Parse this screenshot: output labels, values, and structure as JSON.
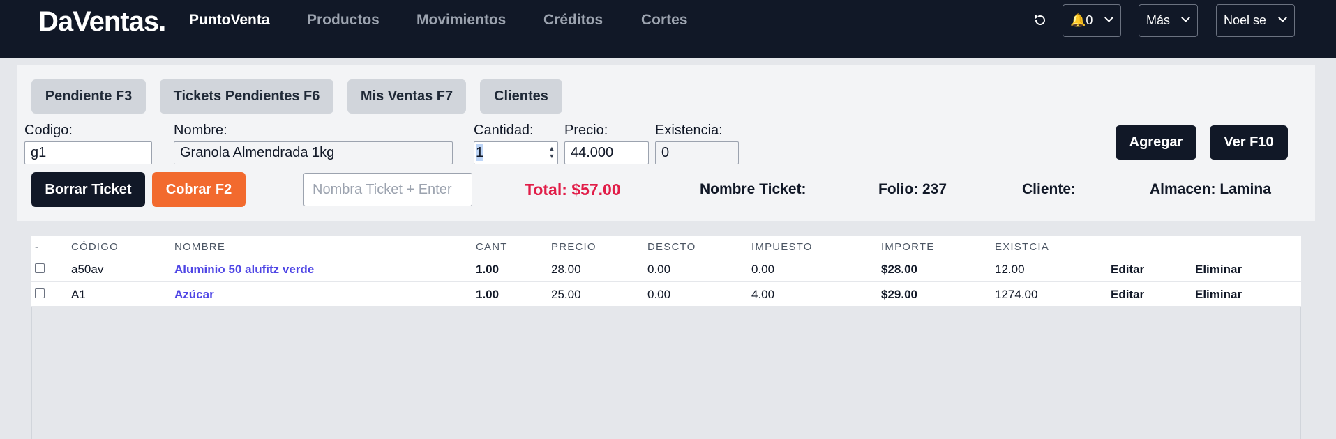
{
  "brand": "DaVentas.",
  "nav": {
    "links": [
      "PuntoVenta",
      "Productos",
      "Movimientos",
      "Créditos",
      "Cortes"
    ],
    "refresh_icon": "refresh-icon",
    "notifications": "🔔0",
    "mas": "Más",
    "user": "Noel se"
  },
  "toolbar": {
    "tabs": [
      "Pendiente F3",
      "Tickets Pendientes F6",
      "Mis Ventas F7",
      "Clientes"
    ]
  },
  "form": {
    "codigo_label": "Codigo:",
    "codigo_value": "g1",
    "nombre_label": "Nombre:",
    "nombre_value": "Granola Almendrada 1kg",
    "cantidad_label": "Cantidad:",
    "cantidad_value": "1",
    "precio_label": "Precio:",
    "precio_value": "44.000",
    "existencia_label": "Existencia:",
    "existencia_value": "0",
    "agregar": "Agregar",
    "ver": "Ver F10",
    "borrar": "Borrar Ticket",
    "cobrar": "Cobrar F2",
    "ticket_placeholder": "Nombra Ticket + Enter",
    "total": "Total: $57.00",
    "nombre_ticket": "Nombre Ticket:",
    "folio": "Folio: 237",
    "cliente": "Cliente:",
    "almacen": "Almacen: Lamina"
  },
  "table": {
    "headers": [
      "-",
      "Código",
      "Nombre",
      "Cant",
      "Precio",
      "Descto",
      "Impuesto",
      "Importe",
      "Existcia"
    ],
    "rows": [
      {
        "codigo": "a50av",
        "nombre": "Aluminio 50 alufitz verde",
        "cant": "1.00",
        "precio": "28.00",
        "descto": "0.00",
        "impuesto": "0.00",
        "importe": "$28.00",
        "existcia": "12.00",
        "editar": "Editar",
        "eliminar": "Eliminar"
      },
      {
        "codigo": "A1",
        "nombre": "Azúcar",
        "cant": "1.00",
        "precio": "25.00",
        "descto": "0.00",
        "impuesto": "4.00",
        "importe": "$29.00",
        "existcia": "1274.00",
        "editar": "Editar",
        "eliminar": "Eliminar"
      }
    ]
  },
  "colors": {
    "nav_bg": "#111827",
    "total": "#e11d48",
    "cobrar": "#f26a2e",
    "link": "#4f46e5"
  }
}
